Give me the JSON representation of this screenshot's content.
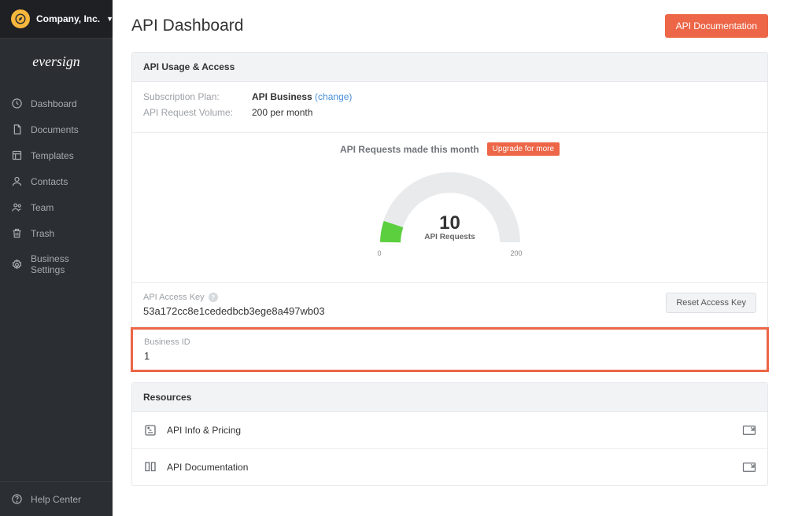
{
  "sidebar": {
    "company_name": "Company, Inc.",
    "nav": [
      {
        "label": "Dashboard"
      },
      {
        "label": "Documents"
      },
      {
        "label": "Templates"
      },
      {
        "label": "Contacts"
      },
      {
        "label": "Team"
      },
      {
        "label": "Trash"
      },
      {
        "label": "Business Settings"
      }
    ],
    "help_label": "Help Center"
  },
  "header": {
    "title": "API Dashboard",
    "doc_button": "API Documentation"
  },
  "usage_panel": {
    "title": "API Usage & Access",
    "plan_label": "Subscription Plan:",
    "plan_value": "API Business",
    "plan_change": "(change)",
    "volume_label": "API Request Volume:",
    "volume_value": "200 per month",
    "requests_header": "API Requests made this month",
    "upgrade_text": "Upgrade for more",
    "gauge": {
      "count": "10",
      "subtext": "API Requests",
      "min": "0",
      "max": "200"
    },
    "access_key_label": "API Access Key",
    "access_key_value": "53a172cc8e1cededbcb3ege8a497wb03",
    "reset_button": "Reset Access Key",
    "business_id_label": "Business ID",
    "business_id_value": "1"
  },
  "resources_panel": {
    "title": "Resources",
    "items": [
      {
        "label": "API Info & Pricing"
      },
      {
        "label": "API Documentation"
      }
    ]
  }
}
